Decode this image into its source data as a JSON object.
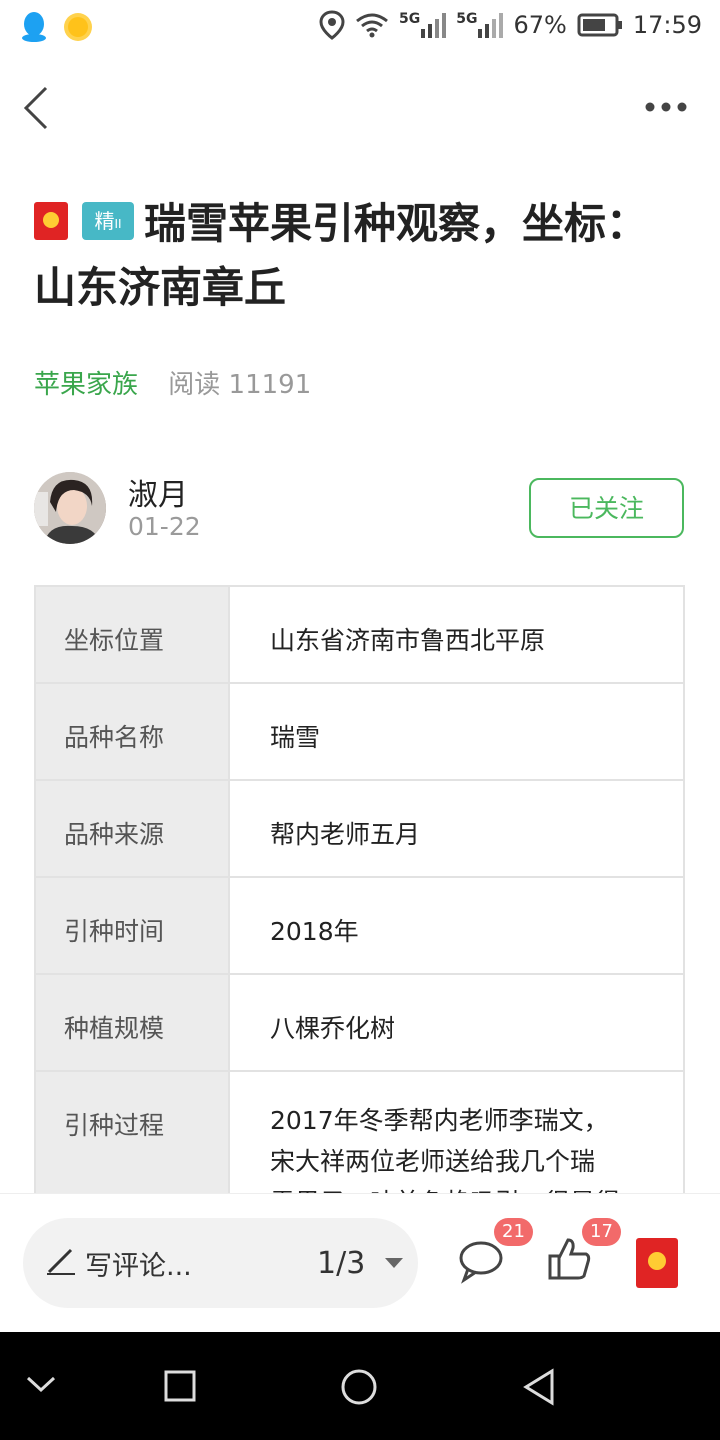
{
  "status_bar": {
    "network_left": "5G",
    "network_right": "5G",
    "battery": "67%",
    "time": "17:59"
  },
  "article": {
    "badge_jing": "精",
    "badge_jing_sub": "II",
    "title": "瑞雪苹果引种观察，坐标：山东济南章丘",
    "group": "苹果家族",
    "reads": "阅读 11191"
  },
  "author": {
    "name": "淑月",
    "date": "01-22",
    "follow_label": "已关注"
  },
  "table": {
    "rows": [
      {
        "key": "坐标位置",
        "value": "山东省济南市鲁西北平原"
      },
      {
        "key": "品种名称",
        "value": "瑞雪"
      },
      {
        "key": "品种来源",
        "value": "帮内老师五月"
      },
      {
        "key": "引种时间",
        "value": "2018年"
      },
      {
        "key": "种植规模",
        "value": "八棵乔化树"
      },
      {
        "key": "引种过程",
        "value_line1": "2017年冬季帮内老师李瑞文，",
        "value_line2": "宋大祥两位老师送给我几个瑞",
        "value_line3": "雪果子，味美色艳吸引，很是得"
      }
    ]
  },
  "bottom_bar": {
    "comment_placeholder": "写评论...",
    "page": "1/3",
    "comment_count": "21",
    "like_count": "17"
  },
  "colors": {
    "accent_green": "#4bb85e",
    "badge_red": "#e02424",
    "count_badge": "#f26a6a"
  }
}
